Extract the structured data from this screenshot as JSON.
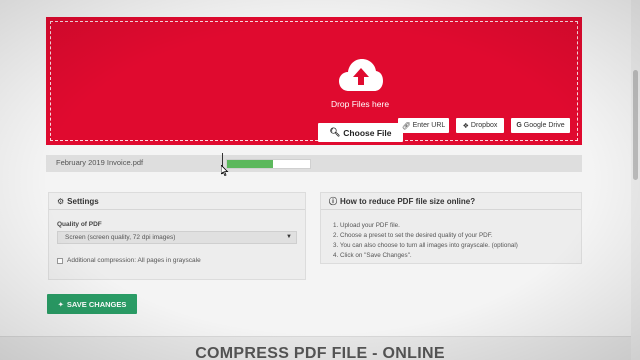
{
  "upload": {
    "drop_text": "Drop Files here",
    "choose_label": "Choose File",
    "sources": {
      "url_label": "Enter URL",
      "dropbox_label": "Dropbox",
      "gdrive_label": "Google Drive"
    },
    "accent_color": "#e00a2f"
  },
  "file": {
    "name": "February 2019 Invoice.pdf",
    "progress": 0.55,
    "progress_color": "#5cb85c"
  },
  "settings": {
    "title": "Settings",
    "quality_label": "Quality of PDF",
    "quality_value": "Screen (screen quality, 72 dpi images)",
    "additional_label": "Additional compression: All pages in grayscale"
  },
  "howto": {
    "title": "How to reduce PDF file size online?",
    "steps": [
      "1. Upload your PDF file.",
      "2. Choose a preset to set the desired quality of your PDF.",
      "3. You can also choose to turn all images into grayscale. (optional)",
      "4. Click on \"Save Changes\"."
    ]
  },
  "actions": {
    "save_label": "SAVE CHANGES",
    "save_color": "#2a9d66"
  },
  "footer": {
    "title": "COMPRESS PDF FILE - ONLINE"
  }
}
